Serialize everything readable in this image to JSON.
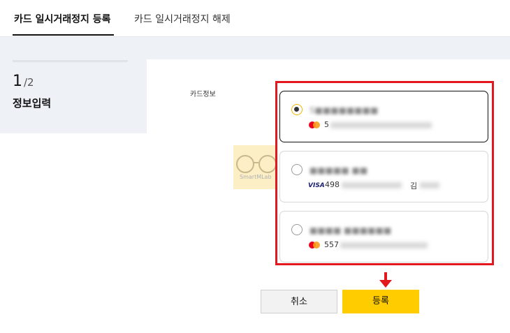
{
  "tabs": [
    {
      "label": "카드 일시거래정지 등록",
      "active": true
    },
    {
      "label": "카드 일시거래정지 해제",
      "active": false
    }
  ],
  "step": {
    "current": "1",
    "total": "/2",
    "label": "정보입력"
  },
  "form": {
    "field_label": "카드정보"
  },
  "watermark": {
    "text": "SmartMLab"
  },
  "cards": [
    {
      "brand": "mastercard-icon",
      "name": "S■■■■■■■■",
      "number": "5",
      "selected": true
    },
    {
      "brand": "visa",
      "brand_label": "VISA",
      "name": "■■■■■ ■■",
      "number": "498",
      "suffix": "김",
      "selected": false
    },
    {
      "brand": "mastercard-icon",
      "name": "■■■■ ■■■■■■",
      "number": "557",
      "selected": false
    }
  ],
  "buttons": {
    "cancel": "취소",
    "submit": "등록"
  },
  "colors": {
    "accent": "#ffcc00",
    "highlight": "#e3171e",
    "panel": "#eef1f6"
  }
}
